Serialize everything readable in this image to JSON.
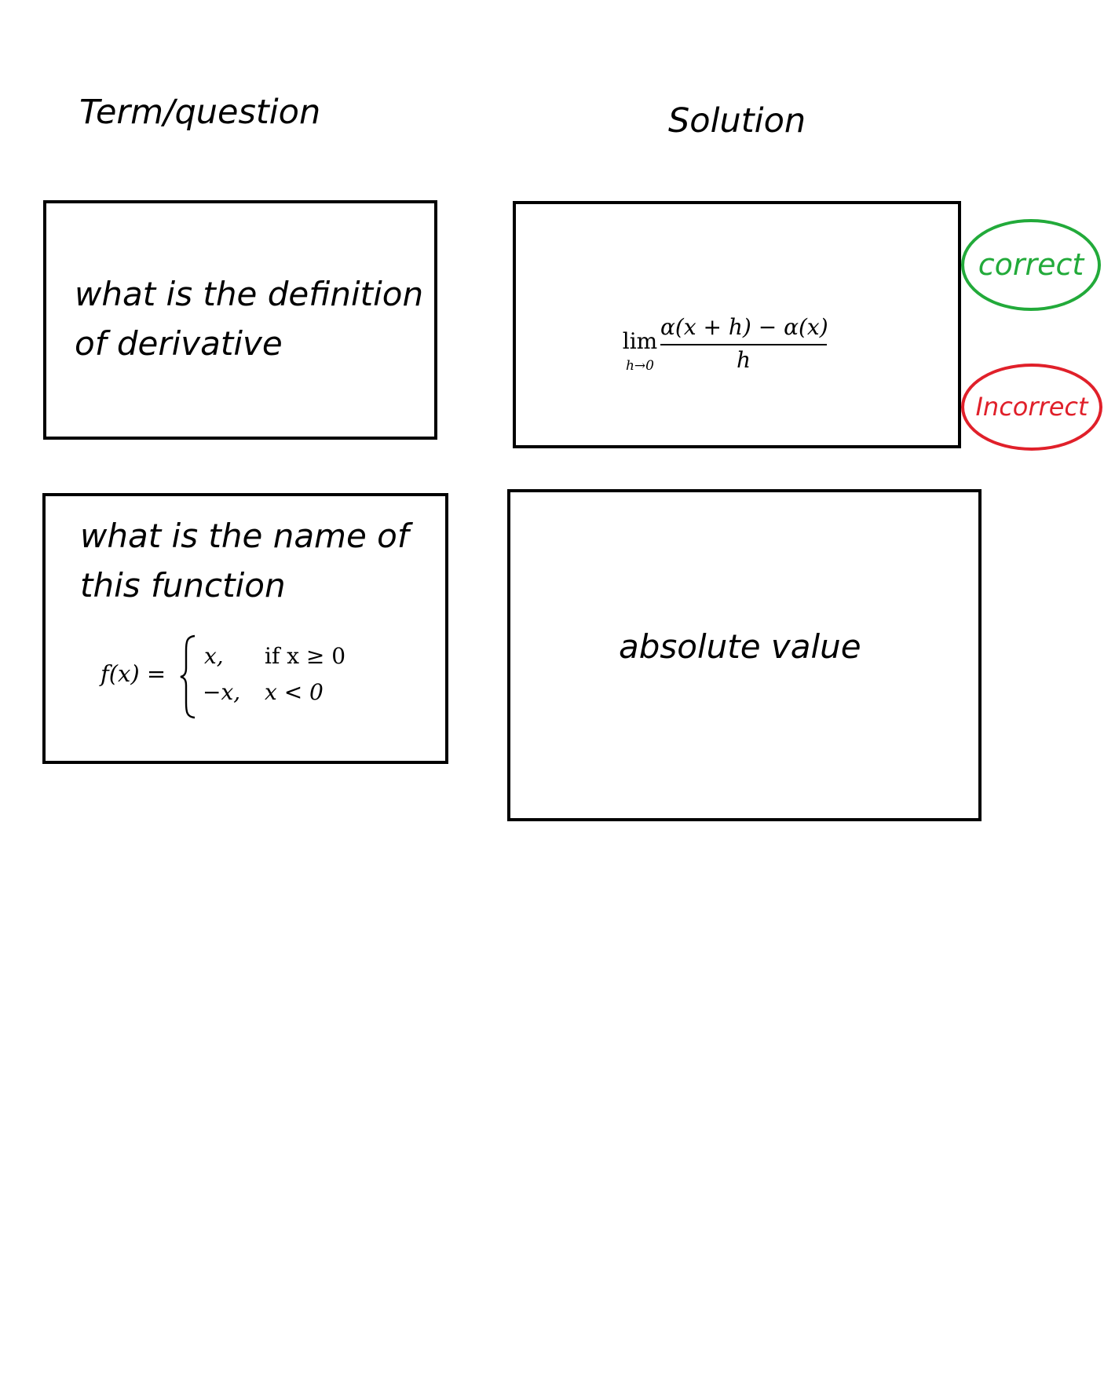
{
  "headers": {
    "term": "Term/question",
    "solution": "Solution"
  },
  "cards": [
    {
      "question_lines": [
        "what is the definition",
        "of derivative"
      ],
      "solution_formula": {
        "operator": "lim",
        "subscript": "h→0",
        "numerator": "α(x + h) − α(x)",
        "denominator": "h"
      }
    },
    {
      "question_lines": [
        "what is the name of",
        "this function"
      ],
      "question_formula": {
        "lhs": "f(x) =",
        "cases": [
          {
            "value": "x,",
            "condition": "if x ≥ 0"
          },
          {
            "value": "−x,",
            "condition": "x < 0"
          }
        ]
      },
      "solution_text": "absolute value"
    }
  ],
  "marks": {
    "correct": "correct",
    "incorrect": "Incorrect"
  },
  "colors": {
    "correct": "#22aa3a",
    "incorrect": "#e0202a"
  }
}
